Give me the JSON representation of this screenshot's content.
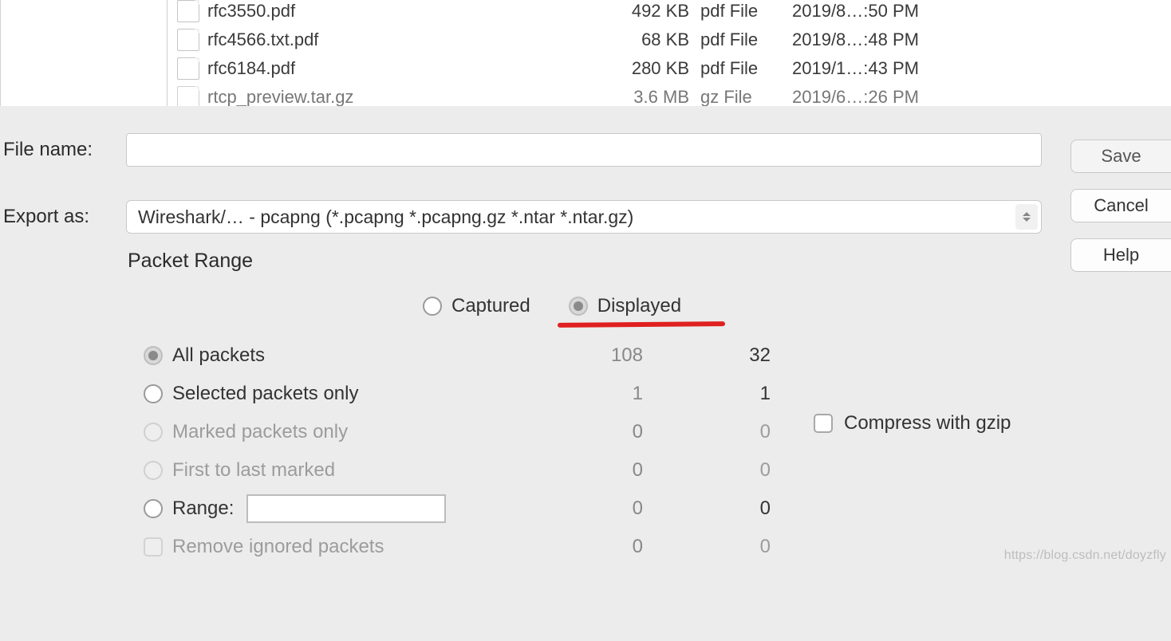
{
  "file_browser": {
    "rows": [
      {
        "name": "rfc3550.pdf",
        "size": "492 KB",
        "kind": "pdf File",
        "date": "2019/8…:50 PM",
        "cut": false
      },
      {
        "name": "rfc4566.txt.pdf",
        "size": "68 KB",
        "kind": "pdf File",
        "date": "2019/8…:48 PM",
        "cut": false
      },
      {
        "name": "rfc6184.pdf",
        "size": "280 KB",
        "kind": "pdf File",
        "date": "2019/1…:43 PM",
        "cut": false
      },
      {
        "name": "rtcp_preview.tar.gz",
        "size": "3.6 MB",
        "kind": "gz File",
        "date": "2019/6…:26 PM",
        "cut": true
      }
    ]
  },
  "labels": {
    "file_name": "File name:",
    "export_as": "Export as:",
    "save": "Save",
    "cancel": "Cancel",
    "help": "Help",
    "packet_range": "Packet Range",
    "captured": "Captured",
    "displayed": "Displayed",
    "compress_gzip": "Compress with gzip",
    "all_packets": "All packets",
    "selected_only": "Selected packets only",
    "marked_only": "Marked packets only",
    "first_to_last": "First to last marked",
    "range": "Range:",
    "remove_ignored": "Remove ignored packets"
  },
  "fields": {
    "file_name_value": "",
    "export_as_value": "Wireshark/… - pcapng (*.pcapng *.pcapng.gz *.ntar *.ntar.gz)",
    "range_value": ""
  },
  "counts": {
    "all": {
      "captured": "108",
      "displayed": "32"
    },
    "selected": {
      "captured": "1",
      "displayed": "1"
    },
    "marked": {
      "captured": "0",
      "displayed": "0"
    },
    "first_last": {
      "captured": "0",
      "displayed": "0"
    },
    "range": {
      "captured": "0",
      "displayed": "0"
    },
    "ignored": {
      "captured": "0",
      "displayed": "0"
    }
  },
  "watermark": "https://blog.csdn.net/doyzfly"
}
